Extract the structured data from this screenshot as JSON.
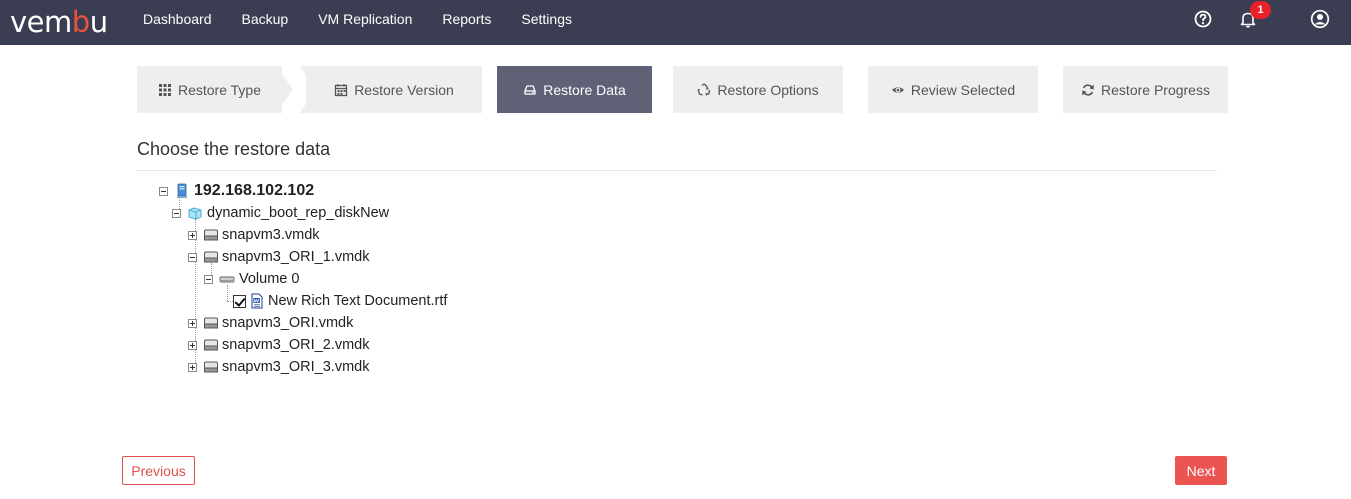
{
  "brand": {
    "logo_pre": "vem",
    "logo_accent": "b",
    "logo_post": "u",
    "accent_color": "#e8523f",
    "navbar_color": "#3b3d52"
  },
  "nav": {
    "items": [
      "Dashboard",
      "Backup",
      "VM Replication",
      "Reports",
      "Settings"
    ]
  },
  "header_icons": {
    "help": "help-icon",
    "bell": "bell-icon",
    "user": "user-icon",
    "notification_count": "1"
  },
  "wizard": {
    "steps": [
      {
        "label": "Restore Type",
        "icon": "grid-icon",
        "active": false
      },
      {
        "label": "Restore Version",
        "icon": "calendar-icon",
        "active": false
      },
      {
        "label": "Restore Data",
        "icon": "drive-icon",
        "active": true
      },
      {
        "label": "Restore Options",
        "icon": "recycle-icon",
        "active": false
      },
      {
        "label": "Review Selected",
        "icon": "eye-icon",
        "active": false
      },
      {
        "label": "Restore Progress",
        "icon": "refresh-icon",
        "active": false
      }
    ]
  },
  "main": {
    "heading": "Choose the restore data"
  },
  "tree": {
    "root": "192.168.102.102",
    "vm": "dynamic_boot_rep_diskNew",
    "disks": [
      "snapvm3.vmdk",
      "snapvm3_ORI_1.vmdk",
      "snapvm3_ORI.vmdk",
      "snapvm3_ORI_2.vmdk",
      "snapvm3_ORI_3.vmdk"
    ],
    "volume": "Volume 0",
    "file": "New Rich Text Document.rtf",
    "file_checked": true
  },
  "buttons": {
    "previous": "Previous",
    "next": "Next"
  }
}
